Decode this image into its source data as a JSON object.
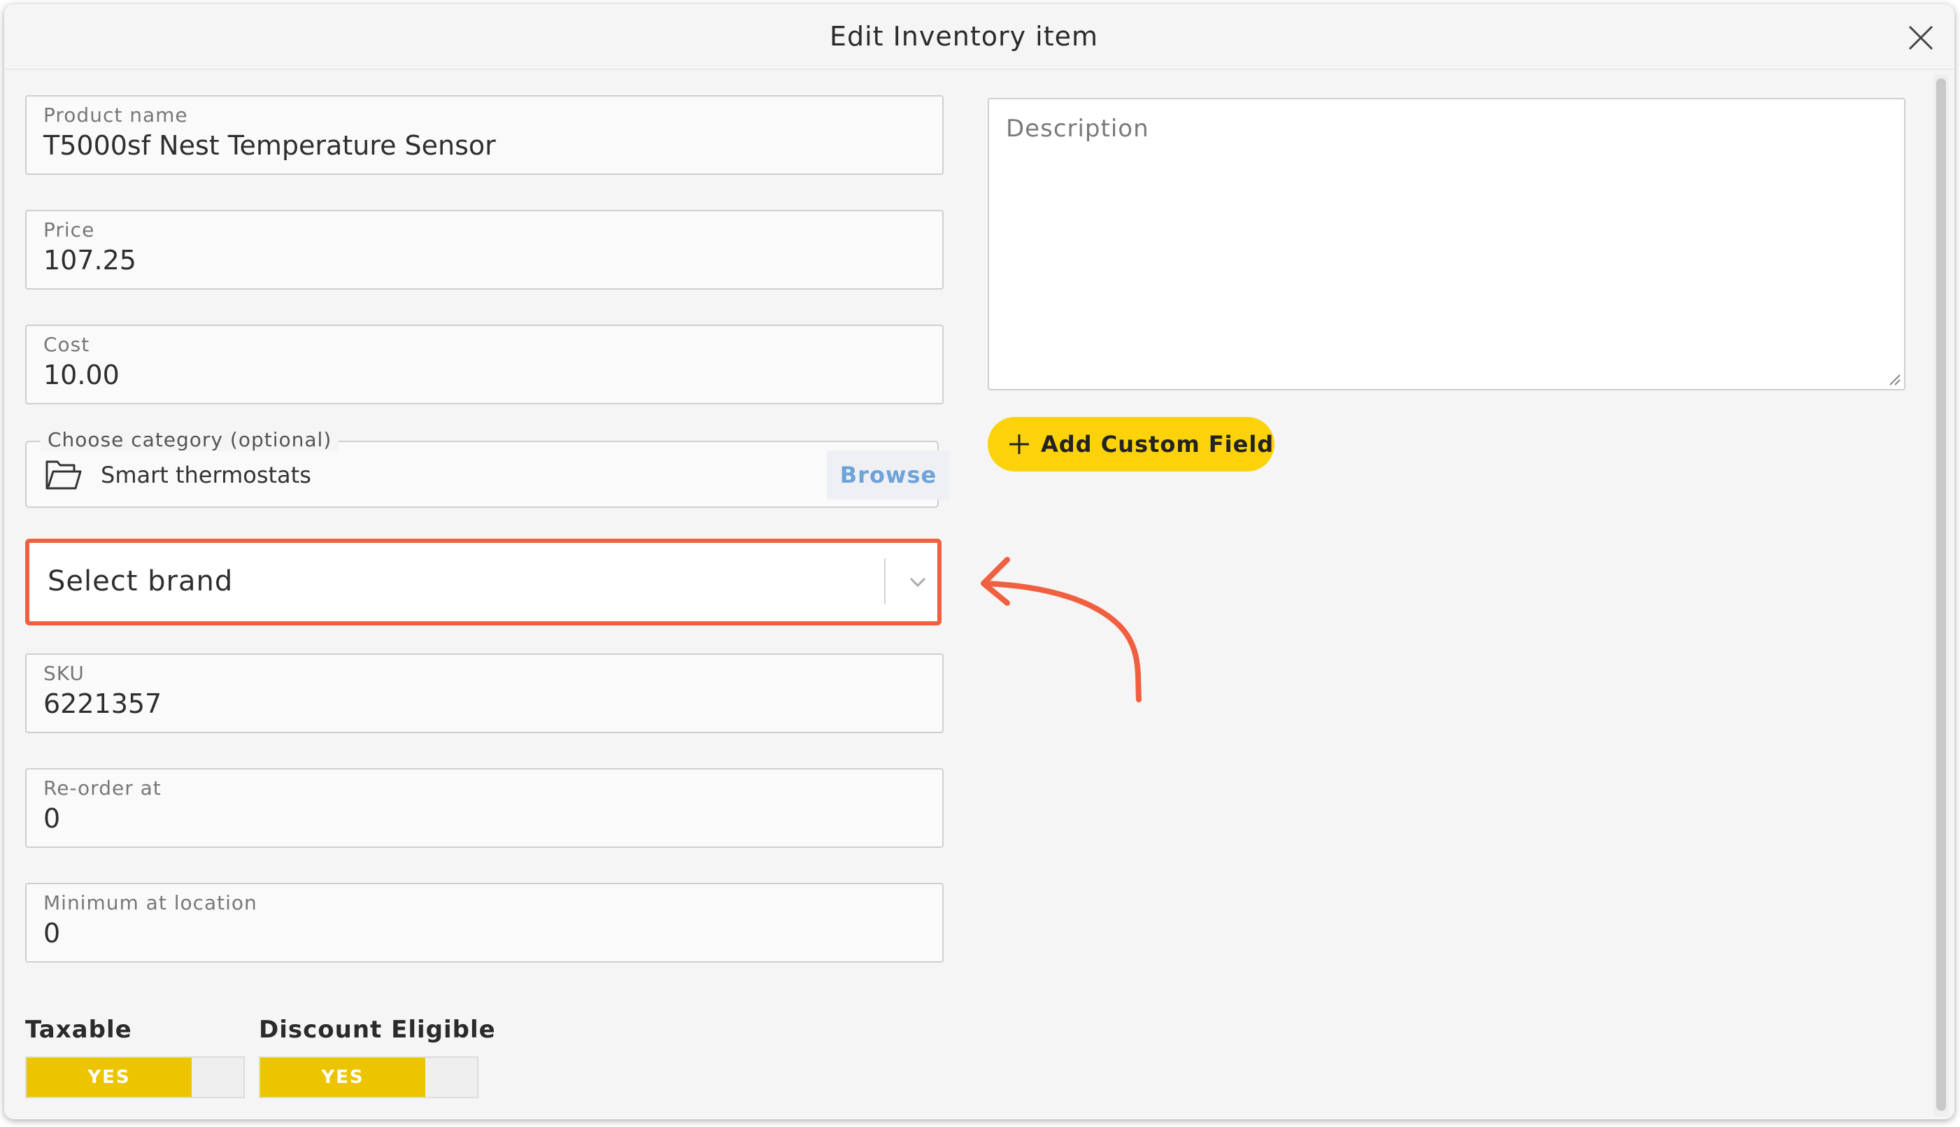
{
  "modal": {
    "title": "Edit Inventory item"
  },
  "fields": {
    "product_name": {
      "label": "Product name",
      "value": "T5000sf Nest Temperature Sensor"
    },
    "price": {
      "label": "Price",
      "value": "107.25"
    },
    "cost": {
      "label": "Cost",
      "value": "10.00"
    },
    "sku": {
      "label": "SKU",
      "value": "6221357"
    },
    "reorder_at": {
      "label": "Re-order at",
      "value": "0"
    },
    "minimum_at_location": {
      "label": "Minimum at location",
      "value": "0"
    }
  },
  "category": {
    "legend": "Choose category (optional)",
    "value": "Smart thermostats",
    "browse_label": "Browse",
    "icon": "folder-icon"
  },
  "brand": {
    "placeholder": "Select brand",
    "icon": "chevron-down-icon",
    "highlight_color": "#f06040"
  },
  "description": {
    "placeholder": "Description"
  },
  "add_custom_field": {
    "label": "Add Custom Field",
    "icon": "plus-icon",
    "color": "#fcd20a"
  },
  "toggles": {
    "taxable": {
      "label": "Taxable",
      "state": "YES"
    },
    "discount_eligible": {
      "label": "Discount Eligible",
      "state": "YES"
    }
  },
  "colors": {
    "accent_yellow": "#fcd20a",
    "toggle_yellow": "#ecc400",
    "annotation_red": "#f06040",
    "browse_blue": "#6fa3d8"
  }
}
